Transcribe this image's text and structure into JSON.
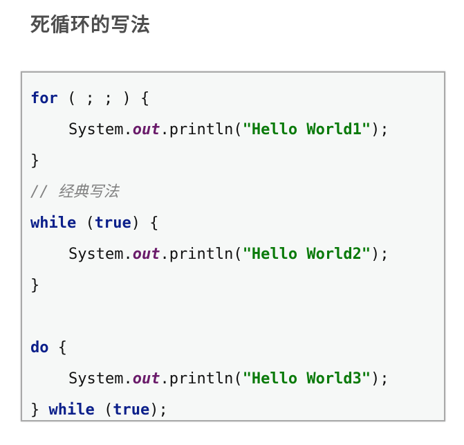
{
  "title": "死循环的写法",
  "code": {
    "for_kw": "for",
    "for_rest": " ( ; ; ) {",
    "system": "System.",
    "out": "out",
    "println": ".println(",
    "str1": "\"Hello World1\"",
    "str2": "\"Hello World2\"",
    "str3": "\"Hello World3\"",
    "close_paren": ");",
    "close_brace": "}",
    "comment": "// 经典写法",
    "while_kw": "while",
    "open_paren": " (",
    "true_kw": "true",
    "while_rest": ") {",
    "do_kw": "do",
    "do_rest": " {",
    "close_brace_space": "} ",
    "while_end_rest": ");"
  }
}
